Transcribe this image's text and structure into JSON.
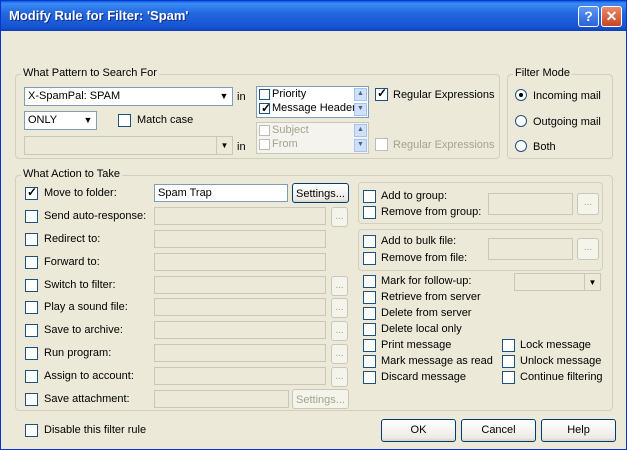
{
  "window": {
    "title": "Modify Rule for Filter: 'Spam'"
  },
  "pattern": {
    "legend": "What Pattern to Search For",
    "field_combo": "X-SpamPal: SPAM",
    "in_label": "in",
    "match_type": "ONLY",
    "match_case": "Match case",
    "list1": [
      "Priority",
      "Message Header"
    ],
    "regex1": "Regular Expressions",
    "in_label2": "in",
    "list2": [
      "Subject",
      "From"
    ],
    "regex2": "Regular Expressions"
  },
  "filter_mode": {
    "legend": "Filter Mode",
    "options": [
      "Incoming mail",
      "Outgoing mail",
      "Both"
    ],
    "selected": "Incoming mail"
  },
  "actions": {
    "legend": "What Action to Take",
    "move_folder": {
      "label": "Move to folder:",
      "value": "Spam Trap",
      "button": "Settings..."
    },
    "send_auto": {
      "label": "Send auto-response:"
    },
    "redirect": {
      "label": "Redirect to:"
    },
    "forward": {
      "label": "Forward to:"
    },
    "switch_filter": {
      "label": "Switch to filter:"
    },
    "play_sound": {
      "label": "Play a sound file:"
    },
    "save_archive": {
      "label": "Save to archive:"
    },
    "run_program": {
      "label": "Run program:"
    },
    "assign_account": {
      "label": "Assign to account:"
    },
    "save_attachment": {
      "label": "Save attachment:",
      "button": "Settings..."
    },
    "browse": "...",
    "add_group": "Add to group:",
    "remove_group": "Remove from group:",
    "add_bulk": "Add to bulk file:",
    "remove_file": "Remove from file:",
    "followup": "Mark for follow-up:",
    "retrieve": "Retrieve from server",
    "delete_server": "Delete from server",
    "delete_local": "Delete local only",
    "print": "Print message",
    "mark_read": "Mark message as read",
    "discard": "Discard message",
    "lock": "Lock message",
    "unlock": "Unlock message",
    "continue": "Continue filtering"
  },
  "footer": {
    "disable": "Disable this filter rule",
    "ok": "OK",
    "cancel": "Cancel",
    "help": "Help"
  }
}
